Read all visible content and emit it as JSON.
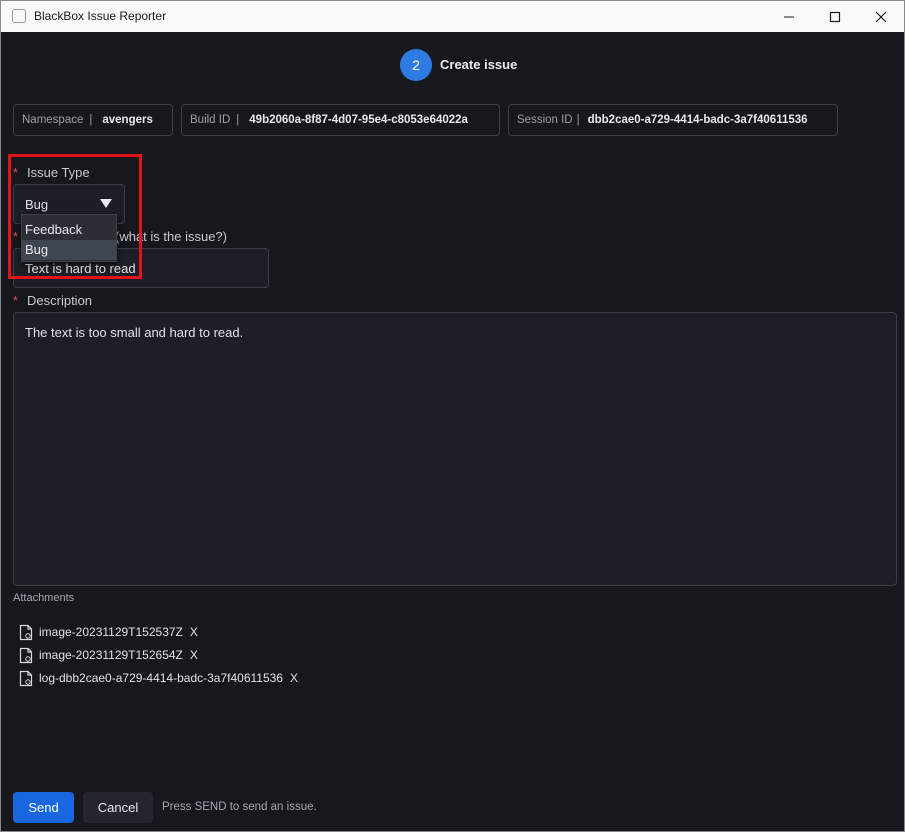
{
  "window": {
    "title": "BlackBox Issue Reporter"
  },
  "stepper": {
    "step_number": "2",
    "step_label": "Create issue"
  },
  "info": {
    "namespace_label": "Namespace",
    "namespace_value": "avengers",
    "build_label": "Build ID",
    "build_value": "49b2060a-8f87-4d07-95e4-c8053e64022a",
    "session_label": "Session ID",
    "session_value": "dbb2cae0-a729-4414-badc-3a7f40611536",
    "separator": "|"
  },
  "form": {
    "required_mark": "*",
    "issue_type_label": "Issue Type",
    "issue_type_value": "Bug",
    "issue_type_options": [
      "Feedback",
      "Bug"
    ],
    "title_label_visible": "(what is the issue?)",
    "title_value": "Text is hard to read",
    "description_label": "Description",
    "description_value": "The text is too small and hard to read."
  },
  "attachments": {
    "label": "Attachments",
    "remove_label": "X",
    "items": [
      "image-20231129T152537Z",
      "image-20231129T152654Z",
      "log-dbb2cae0-a729-4414-badc-3a7f40611536"
    ]
  },
  "actions": {
    "send_label": "Send",
    "cancel_label": "Cancel",
    "hint": "Press SEND to send an issue."
  },
  "colors": {
    "background": "#16181d",
    "accent": "#2f7be3",
    "send_button": "#1867e0",
    "required": "#e24c4c",
    "highlight": "#e3121b"
  }
}
